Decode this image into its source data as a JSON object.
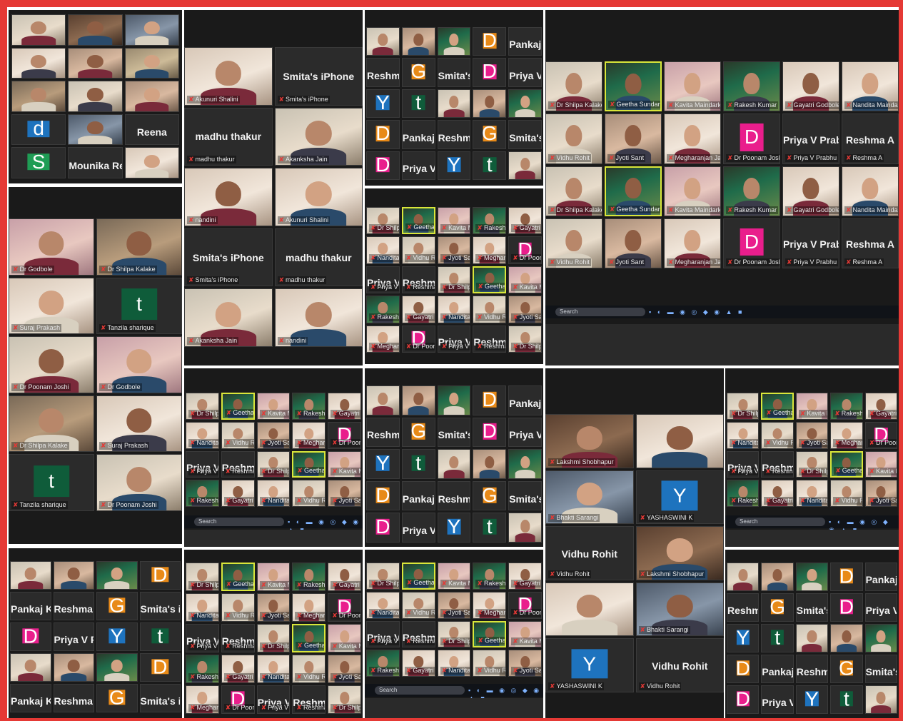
{
  "collage": {
    "title": "",
    "colors": {
      "frame": "#e53935",
      "meeting_bg": "#1a1a1a",
      "active_speaker_border": "#d9e63a",
      "mic_muted": "#e53935"
    },
    "panels": {
      "p1": {
        "tiles": [
          {
            "name": "",
            "v": 1
          },
          {
            "name": "",
            "v": 6
          },
          {
            "name": "",
            "v": 4
          },
          {
            "name": "",
            "v": 5
          },
          {
            "name": "",
            "v": 3
          },
          {
            "name": "",
            "v": 9
          },
          {
            "name": "",
            "v": 0
          },
          {
            "name": "",
            "v": 1
          },
          {
            "name": "",
            "v": 3
          },
          {
            "avatar": "d",
            "color": "#1e73be",
            "name": ""
          },
          {
            "name": "",
            "v": 4
          },
          {
            "big": "Reena",
            "name": ""
          },
          {
            "avatar": "S",
            "color": "#1f9d55",
            "name": ""
          },
          {
            "big": "Mounika Reddy",
            "name": ""
          },
          {
            "name": "",
            "v": 5
          }
        ]
      },
      "p2": {
        "tiles": [
          {
            "name": "Akunuri Shalini",
            "v": 5
          },
          {
            "big": "Smita's iPhone",
            "name": "Smita's iPhone"
          },
          {
            "big": "madhu thakur",
            "name": "madhu thakur"
          },
          {
            "name": "Akanksha Jain",
            "v": 1
          },
          {
            "name": "nandini",
            "v": 5
          }
        ]
      },
      "p3": {
        "tiles": [
          {
            "name": "Dr Godbole",
            "v": 8
          },
          {
            "name": "Dr Shilpa Kalake",
            "v": 0
          },
          {
            "name": "Suraj Prakash",
            "v": 5
          },
          {
            "avatar": "t",
            "color": "#0f5c3a",
            "name": "Tanzila sharique"
          },
          {
            "name": "Dr Poonam Joshi",
            "v": 1
          }
        ]
      },
      "p4": {
        "tiles": [
          {
            "name": "Dr Shilpa Kalake",
            "v": 1
          },
          {
            "name": "Geetha Sundaresh",
            "v": 7,
            "active": true
          },
          {
            "name": "Kavita Maindarkar",
            "v": 8
          },
          {
            "name": "Rakesh Kumar",
            "v": 7
          },
          {
            "name": "Gayatri Godbole",
            "v": 5
          },
          {
            "name": "Nandita Maindarkar",
            "v": 5
          },
          {
            "name": "Vidhu Rohit",
            "v": 1
          },
          {
            "name": "Jyoti Sant",
            "v": 3
          },
          {
            "name": "Megharanjan Jain",
            "v": 5
          },
          {
            "avatar": "D",
            "color": "#e91e8c",
            "name": "Dr Poonam Joshi"
          },
          {
            "big": "Priya V Prabhu",
            "name": "Priya V Prabhu"
          },
          {
            "big": "Reshma A",
            "name": "Reshma A"
          }
        ]
      },
      "p5": {
        "tiles": [
          {
            "name": "Lakshmi Shobhapur",
            "v": 6
          },
          {
            "name": "",
            "v": 5
          },
          {
            "name": "Bhakti Sarangi",
            "v": 4
          },
          {
            "avatar": "Y",
            "color": "#1e73be",
            "name": "YASHASWINI K"
          },
          {
            "big": "Vidhu Rohit",
            "name": "Vidhu Rohit"
          }
        ]
      },
      "mini": {
        "tiles": [
          {
            "name": "",
            "v": 1
          },
          {
            "name": "",
            "v": 3
          },
          {
            "name": "",
            "v": 7
          },
          {
            "avatar": "D",
            "color": "#e88a18",
            "name": ""
          },
          {
            "big": "Pankaj Kumar",
            "name": ""
          },
          {
            "big": "Reshma A",
            "name": ""
          },
          {
            "avatar": "G",
            "color": "#e88a18",
            "name": ""
          },
          {
            "big": "Smita's iPhone",
            "name": ""
          },
          {
            "avatar": "D",
            "color": "#e91e8c",
            "name": ""
          },
          {
            "big": "Priya V Prabhu",
            "name": ""
          },
          {
            "avatar": "Y",
            "color": "#1e73be",
            "name": ""
          },
          {
            "avatar": "t",
            "color": "#0f5c3a",
            "name": ""
          }
        ]
      }
    },
    "taskbar": {
      "search_label": "Search",
      "icons": "▪ ◐ ▬ ◉ ◎ ◆ ◉ ▲ ■"
    }
  }
}
